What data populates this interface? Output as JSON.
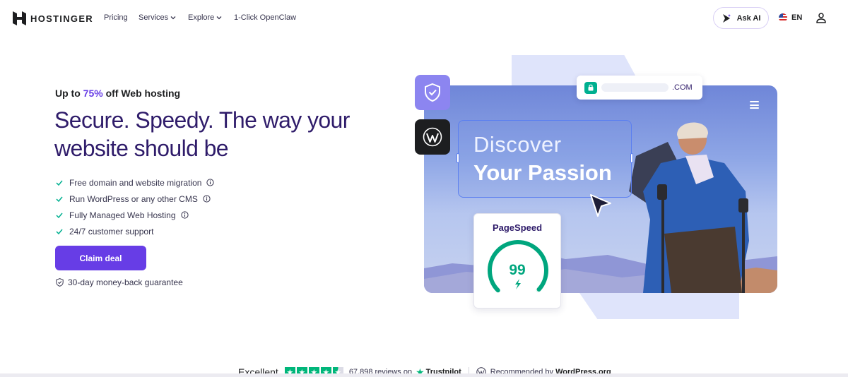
{
  "nav": {
    "brand": "HOSTINGER",
    "items": [
      {
        "label": "Pricing",
        "has_dropdown": false
      },
      {
        "label": "Services",
        "has_dropdown": true
      },
      {
        "label": "Explore",
        "has_dropdown": true
      },
      {
        "label": "1-Click OpenClaw",
        "has_dropdown": false
      }
    ],
    "ask_ai": "Ask AI",
    "language": "EN",
    "icons": {
      "logo": "hostinger-logo-icon",
      "ask_ai": "sparkle-play-icon",
      "flag": "us-flag-icon",
      "account": "user-icon"
    }
  },
  "hero": {
    "promo_prefix": "Up to ",
    "promo_pct": "75%",
    "promo_suffix": " off Web hosting",
    "headline_line1": "Secure. Speedy. The way your",
    "headline_line2": "website should be",
    "features": [
      {
        "text": "Free domain and website migration",
        "has_info": true
      },
      {
        "text": "Run WordPress or any other CMS",
        "has_info": true
      },
      {
        "text": "Fully Managed Web Hosting",
        "has_info": true
      },
      {
        "text": "24/7 customer support",
        "has_info": false
      }
    ],
    "cta": "Claim deal",
    "guarantee": "30-day money-back guarantee"
  },
  "illustration": {
    "url_tld": ".COM",
    "discover_line1": "Discover",
    "discover_line2": "Your Passion",
    "pagespeed_title": "PageSpeed",
    "pagespeed_score": "99",
    "pagespeed_fraction": 0.99
  },
  "trust": {
    "rating_word": "Excellent",
    "stars": 4.5,
    "reviews": "67,898 reviews on",
    "trustpilot": "Trustpilot",
    "recommended_prefix": "Recommended by ",
    "recommended_brand": "WordPress.org"
  },
  "colors": {
    "accent": "#673de6",
    "headline": "#2f1c6a",
    "check": "#00b090",
    "trustpilot_green": "#00b67a"
  }
}
